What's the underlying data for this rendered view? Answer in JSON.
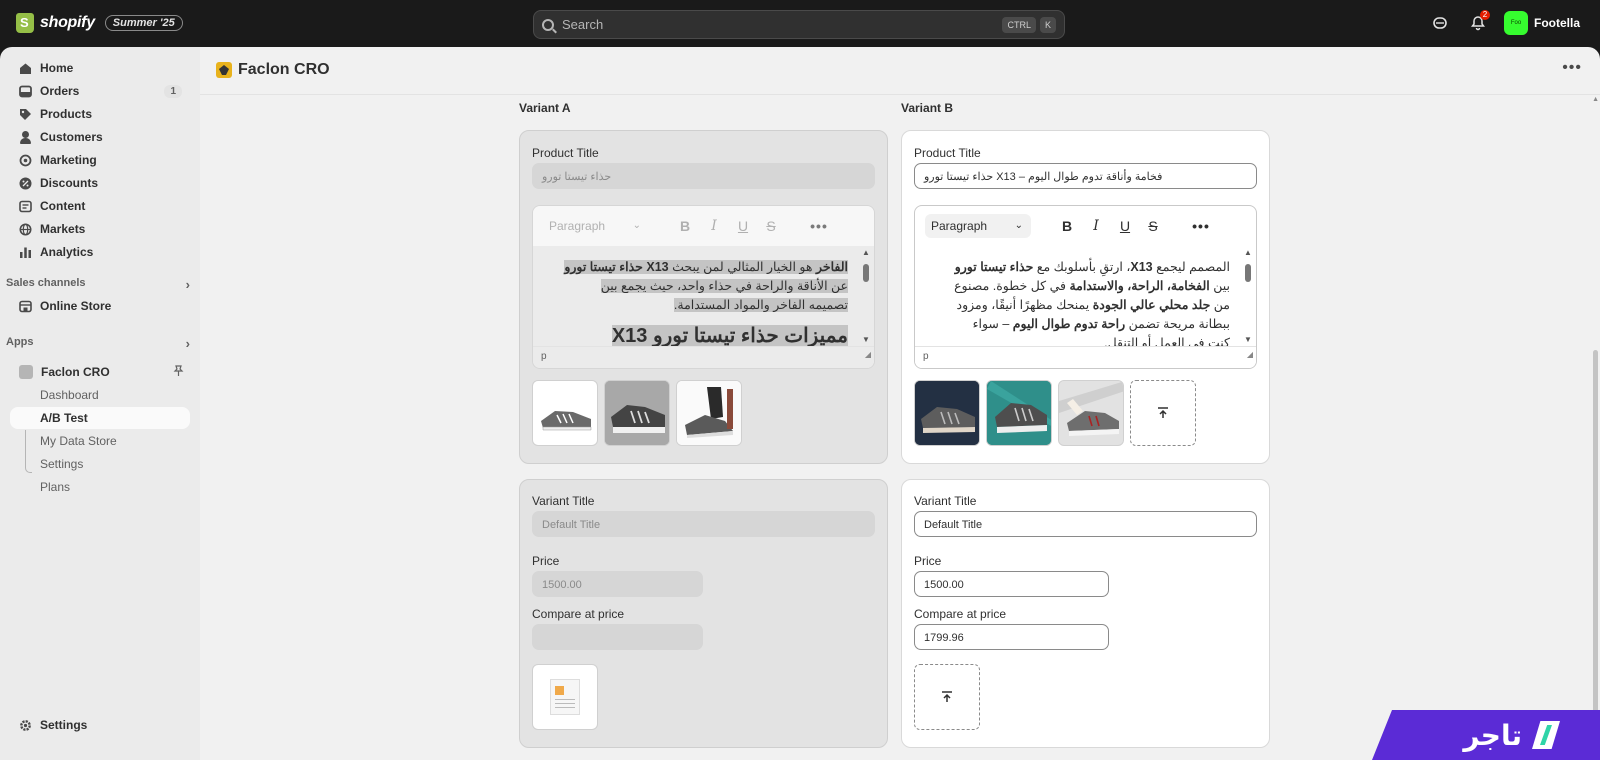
{
  "topbar": {
    "logo_text": "shopify",
    "edition": "Summer '25",
    "search_placeholder": "Search",
    "kbd1": "CTRL",
    "kbd2": "K",
    "notif_count": "2",
    "store_avatar": "Foo",
    "store_name": "Footella"
  },
  "sidebar": {
    "home": "Home",
    "orders": "Orders",
    "orders_count": "1",
    "products": "Products",
    "customers": "Customers",
    "marketing": "Marketing",
    "discounts": "Discounts",
    "content": "Content",
    "markets": "Markets",
    "analytics": "Analytics",
    "sales_channels": "Sales channels",
    "online_store": "Online Store",
    "apps": "Apps",
    "app_name": "Faclon CRO",
    "sub": {
      "dashboard": "Dashboard",
      "ab_test": "A/B Test",
      "data_store": "My Data Store",
      "settings": "Settings",
      "plans": "Plans"
    },
    "settings": "Settings"
  },
  "page": {
    "title": "Faclon CRO"
  },
  "variant_a": {
    "label": "Variant A",
    "product_title_label": "Product Title",
    "product_title_value": "حذاء تيستا تورو",
    "paragraph_select": "Paragraph",
    "body_line1_bold": "الفاخر",
    "body_line1_rest": " هو الخيار المثالي لمن يبحث ",
    "body_line1_bold2": "X13 حذاء تيستا تورو",
    "body_line2": "عن الأناقة والراحة في حذاء واحد، حيث يجمع بين",
    "body_line3": "تصميمه الفاخر والمواد المستدامة.",
    "body_heading": "مميزات حذاء تيستا تورو X13",
    "footer_tag": "p",
    "variant_title_label": "Variant Title",
    "variant_title_value": "Default Title",
    "price_label": "Price",
    "price_value": "1500.00",
    "compare_label": "Compare at price",
    "compare_value": ""
  },
  "variant_b": {
    "label": "Variant B",
    "product_title_label": "Product Title",
    "product_title_value": "فخامة وأناقة تدوم طوال اليوم – X13 حذاء تيستا تورو",
    "paragraph_select": "Paragraph",
    "body_l1_a": "المصمم ليجمع ",
    "body_l1_b": "X13",
    "body_l1_c": "، ارتقِ بأسلوبك مع ",
    "body_l1_d": "حذاء تيستا تورو",
    "body_l2_a": "بين ",
    "body_l2_b": "الفخامة، الراحة، والاستدامة",
    "body_l2_c": " في كل خطوة. مصنوع",
    "body_l3_a": "من ",
    "body_l3_b": "جلد محلي عالي الجودة",
    "body_l3_c": " يمنحك مظهرًا أنيقًا، ومزود",
    "body_l4_a": "ببطانة مريحة تضمن ",
    "body_l4_b": "راحة تدوم طوال اليوم",
    "body_l4_c": " – سواء",
    "body_l5": "كنت في العمل أو التنقل.",
    "footer_tag": "p",
    "variant_title_label": "Variant Title",
    "variant_title_value": "Default Title",
    "price_label": "Price",
    "price_value": "1500.00",
    "compare_label": "Compare at price",
    "compare_value": "1799.96"
  },
  "brand": {
    "text": "تاجر"
  },
  "icons": {
    "upload": "upload-icon"
  }
}
